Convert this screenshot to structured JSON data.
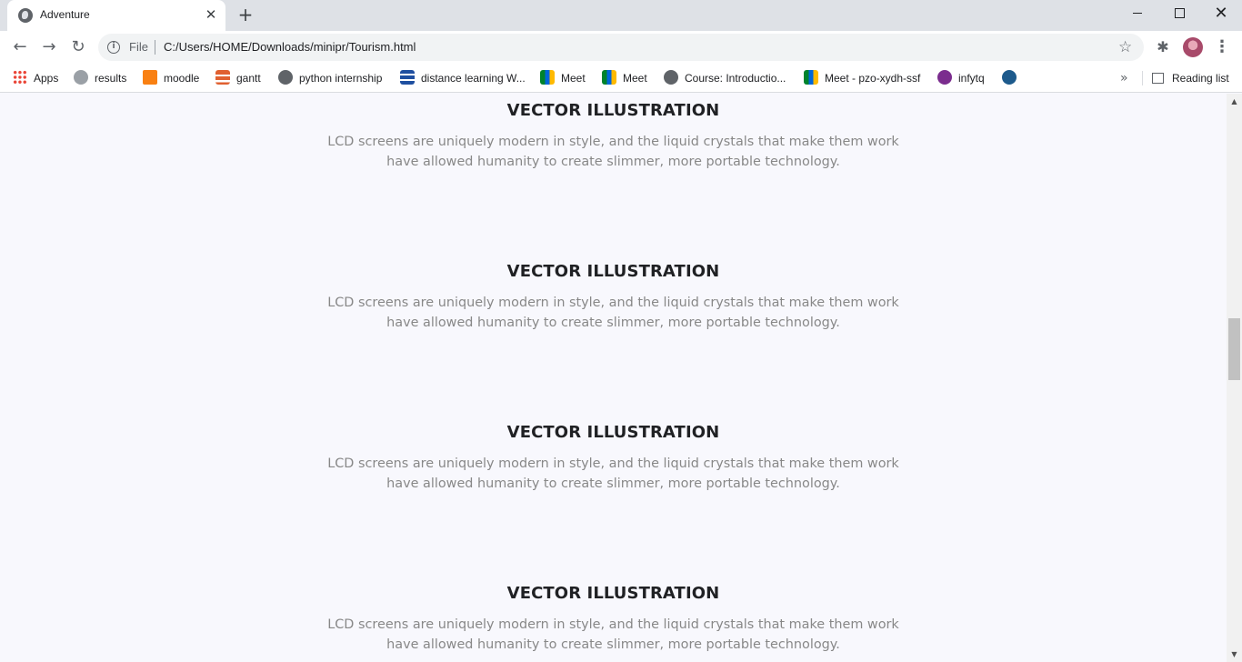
{
  "browser": {
    "tab_title": "Adventure",
    "tab_close": "✕",
    "new_tab": "+",
    "window_close": "✕",
    "omnibox": {
      "scheme_label": "File",
      "url": "C:/Users/HOME/Downloads/minipr/Tourism.html"
    },
    "bookmarks": [
      {
        "label": "Apps",
        "icon": "apps-grid-icon"
      },
      {
        "label": "results",
        "icon": "results-icon"
      },
      {
        "label": "moodle",
        "icon": "moodle-icon"
      },
      {
        "label": "gantt",
        "icon": "gantt-icon"
      },
      {
        "label": "python internship",
        "icon": "globe-icon"
      },
      {
        "label": "distance learning W...",
        "icon": "distance-learning-icon"
      },
      {
        "label": "Meet",
        "icon": "meet-icon"
      },
      {
        "label": "Meet",
        "icon": "meet-icon"
      },
      {
        "label": "Course: Introductio...",
        "icon": "globe-icon"
      },
      {
        "label": "Meet - pzo-xydh-ssf",
        "icon": "meet-icon"
      },
      {
        "label": "infytq",
        "icon": "infytq-icon"
      },
      {
        "label": "",
        "icon": "bookmark-icon"
      }
    ],
    "bookmarks_overflow": "»",
    "reading_list": "Reading list"
  },
  "page": {
    "features": [
      {
        "title": "VECTOR ILLUSTRATION",
        "body": "LCD screens are uniquely modern in style, and the liquid crystals that make them work have allowed humanity to create slimmer, more portable technology."
      },
      {
        "title": "VECTOR ILLUSTRATION",
        "body": "LCD screens are uniquely modern in style, and the liquid crystals that make them work have allowed humanity to create slimmer, more portable technology."
      },
      {
        "title": "VECTOR ILLUSTRATION",
        "body": "LCD screens are uniquely modern in style, and the liquid crystals that make them work have allowed humanity to create slimmer, more portable technology."
      },
      {
        "title": "VECTOR ILLUSTRATION",
        "body": "LCD screens are uniquely modern in style, and the liquid crystals that make them work have allowed humanity to create slimmer, more portable technology."
      }
    ]
  },
  "colors": {
    "page_background": "#f8f8fd",
    "heading": "#202124",
    "body_text": "#888888"
  }
}
